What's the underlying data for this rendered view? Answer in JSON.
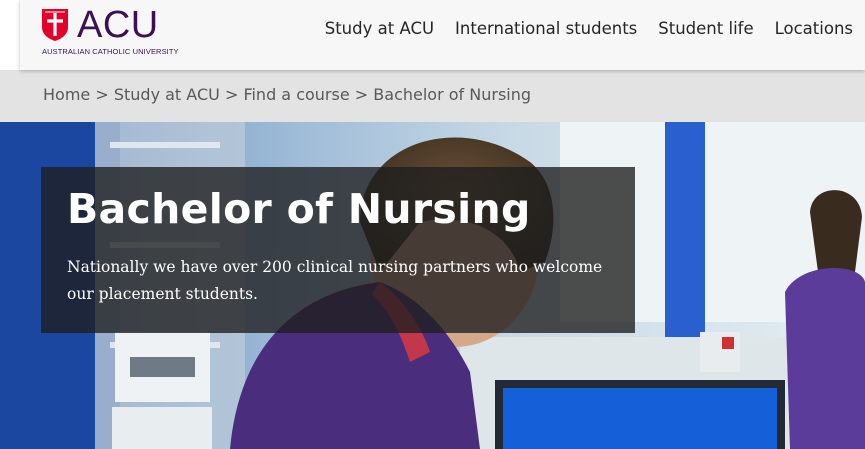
{
  "brand": {
    "name": "ACU",
    "subtitle": "AUSTRALIAN CATHOLIC UNIVERSITY",
    "color": "#3c1053",
    "accent": "#e4002b"
  },
  "nav": {
    "items": [
      {
        "label": "Study at ACU"
      },
      {
        "label": "International students"
      },
      {
        "label": "Student life"
      },
      {
        "label": "Locations"
      }
    ]
  },
  "breadcrumb": {
    "items": [
      {
        "label": "Home"
      },
      {
        "label": "Study at ACU"
      },
      {
        "label": "Find a course"
      },
      {
        "label": "Bachelor of Nursing"
      }
    ],
    "separator": ">"
  },
  "hero": {
    "title": "Bachelor of Nursing",
    "description": "Nationally we have over 200 clinical nursing partners who welcome our placement students."
  }
}
